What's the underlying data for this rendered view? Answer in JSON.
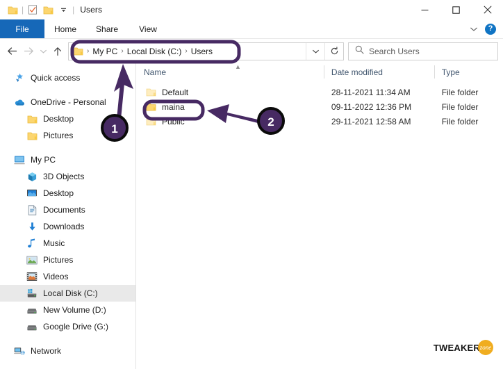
{
  "window": {
    "title": "Users",
    "quick_access": [
      "folder-icon",
      "properties-checkmark-icon",
      "new-folder-icon",
      "customize-chevron-icon"
    ],
    "controls": {
      "minimize": "minimize-icon",
      "maximize": "maximize-icon",
      "close": "close-icon"
    }
  },
  "ribbon": {
    "tabs": [
      {
        "label": "File",
        "active": true
      },
      {
        "label": "Home",
        "active": false
      },
      {
        "label": "Share",
        "active": false
      },
      {
        "label": "View",
        "active": false
      }
    ],
    "expand": "chevron-down-icon",
    "help": "?"
  },
  "addressbar": {
    "back": "back-arrow-icon",
    "forward": "forward-arrow-icon",
    "recent": "chevron-down-icon",
    "up": "up-arrow-icon",
    "folder_icon": "folder-icon",
    "crumbs": [
      "My PC",
      "Local Disk (C:)",
      "Users"
    ],
    "separator": "›",
    "dropdown": "chevron-down-icon",
    "refresh": "refresh-icon"
  },
  "search": {
    "icon": "search-icon",
    "placeholder": "Search Users",
    "value": ""
  },
  "sidebar": {
    "items": [
      {
        "label": "Quick access",
        "icon": "star-pin-icon",
        "indent": false,
        "selected": false,
        "gap_before": false
      },
      {
        "label": "OneDrive - Personal",
        "icon": "cloud-icon",
        "indent": false,
        "selected": false,
        "gap_before": true
      },
      {
        "label": "Desktop",
        "icon": "folder-icon",
        "indent": true,
        "selected": false,
        "gap_before": false
      },
      {
        "label": "Pictures",
        "icon": "folder-icon",
        "indent": true,
        "selected": false,
        "gap_before": false
      },
      {
        "label": "My PC",
        "icon": "monitor-icon",
        "indent": false,
        "selected": false,
        "gap_before": true
      },
      {
        "label": "3D Objects",
        "icon": "cube-icon",
        "indent": true,
        "selected": false,
        "gap_before": false
      },
      {
        "label": "Desktop",
        "icon": "desktop-icon",
        "indent": true,
        "selected": false,
        "gap_before": false
      },
      {
        "label": "Documents",
        "icon": "document-icon",
        "indent": true,
        "selected": false,
        "gap_before": false
      },
      {
        "label": "Downloads",
        "icon": "download-arrow-icon",
        "indent": true,
        "selected": false,
        "gap_before": false
      },
      {
        "label": "Music",
        "icon": "music-note-icon",
        "indent": true,
        "selected": false,
        "gap_before": false
      },
      {
        "label": "Pictures",
        "icon": "picture-icon",
        "indent": true,
        "selected": false,
        "gap_before": false
      },
      {
        "label": "Videos",
        "icon": "video-icon",
        "indent": true,
        "selected": false,
        "gap_before": false
      },
      {
        "label": "Local Disk (C:)",
        "icon": "local-disk-icon",
        "indent": true,
        "selected": true,
        "gap_before": false
      },
      {
        "label": "New Volume (D:)",
        "icon": "drive-icon",
        "indent": true,
        "selected": false,
        "gap_before": false
      },
      {
        "label": "Google Drive (G:)",
        "icon": "drive-icon",
        "indent": true,
        "selected": false,
        "gap_before": false
      },
      {
        "label": "Network",
        "icon": "network-icon",
        "indent": false,
        "selected": false,
        "gap_before": true
      }
    ]
  },
  "filelist": {
    "columns": [
      "Name",
      "Date modified",
      "Type"
    ],
    "sort_indicator": "ascending-caret-icon",
    "rows": [
      {
        "name": "Default",
        "date_modified": "28-11-2021 11:34 AM",
        "type": "File folder",
        "icon": "folder-icon-faded"
      },
      {
        "name": "maina",
        "date_modified": "09-11-2022 12:36 PM",
        "type": "File folder",
        "icon": "folder-icon"
      },
      {
        "name": "Public",
        "date_modified": "29-11-2021 12:58 AM",
        "type": "File folder",
        "icon": "folder-icon-faded"
      }
    ]
  },
  "annotations": {
    "accent_color": "#472a63",
    "ring_color": "#0b0b0b",
    "markers": [
      {
        "number": "1",
        "target": "address-bar"
      },
      {
        "number": "2",
        "target": "maina-folder-row"
      }
    ]
  },
  "watermark": {
    "text": "TWEAKER",
    "badge_text": "zone",
    "badge_color": "#f0ad20"
  }
}
